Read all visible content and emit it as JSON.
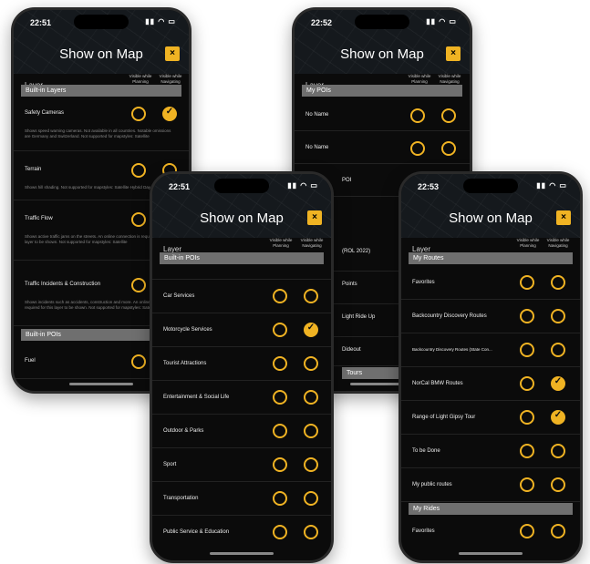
{
  "phone1": {
    "time": "22:51",
    "title": "Show on Map",
    "close": "×",
    "layer_label": "Layer",
    "col_planning": "Visible while Planning",
    "col_navigating": "Visible while Navigating",
    "section1": "Built-in Layers",
    "rows": [
      {
        "label": "Safety Cameras",
        "desc": "Shows speed warning cameras. Not available in all countries. Notable omissions are Germany and Switzerland. Not supported for mapstyles: Satellite"
      },
      {
        "label": "Terrain",
        "desc": "Shows hill shading. Not supported for mapstyles: Satellite Hybrid Day, Hybrid Night"
      },
      {
        "label": "Traffic Flow",
        "desc": "Shows active traffic jams on the streets. An online connection is required for this layer to be shown. Not supported for mapstyles: Satellite"
      },
      {
        "label": "Traffic Incidents & Construction",
        "desc": "Shows incidents such as accidents, construction and more. An online connection is required for this layer to be shown. Not supported for mapstyles: Satellite"
      }
    ],
    "section2": "Built-in POIs",
    "row_fuel": "Fuel"
  },
  "phone2": {
    "time": "22:52",
    "title": "Show on Map",
    "close": "×",
    "layer_label": "Layer",
    "col_planning": "Visible while Planning",
    "col_navigating": "Visible while Navigating",
    "section1": "My POIs",
    "rows": [
      "No Name",
      "No Name",
      "POI",
      "(ROL 2022)",
      "Points",
      "Light Ride Up",
      "Dideout"
    ],
    "section2": "Tours"
  },
  "phone3": {
    "time": "22:51",
    "title": "Show on Map",
    "close": "×",
    "layer_label": "Layer",
    "col_planning": "Visible while Planning",
    "col_navigating": "Visible while Navigating",
    "section1": "Built-in POIs",
    "rows": [
      "Car Services",
      "Motorcycle Services",
      "Tourist Attractions",
      "Entertainment & Social Life",
      "Outdoor & Parks",
      "Sport",
      "Transportation",
      "Public Service & Education"
    ]
  },
  "phone4": {
    "time": "22:53",
    "title": "Show on Map",
    "close": "×",
    "layer_label": "Layer",
    "col_planning": "Visible while Planning",
    "col_navigating": "Visible while Navigating",
    "section1": "My Routes",
    "rows": [
      "Favorites",
      "Backcountry Discovery Routes",
      "Backcountry Discovery Routes (State Con...",
      "NorCal BMW Routes",
      "Range of Light Gipsy Tour",
      "To be Done",
      "My public routes"
    ],
    "section2": "My Rides",
    "row_last": "Favorites"
  },
  "colors": {
    "accent": "#f0b323",
    "background": "#0b0b0b",
    "section": "#6f6f6f"
  }
}
